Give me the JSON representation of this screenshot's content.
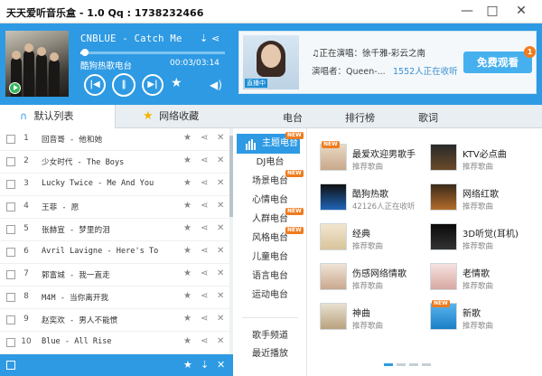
{
  "window": {
    "title": "天天爱听音乐盒 - 1.0      Qq : 1738232466",
    "min": "—",
    "max": "□",
    "close": "✕"
  },
  "player": {
    "song_title": "CNBLUE - Catch Me",
    "station": "酷狗热歌电台",
    "time": "00:03/03:14",
    "progress": 0.02,
    "icons": [
      "download-icon",
      "share-icon",
      "prev-icon",
      "pause-icon",
      "next-icon",
      "favorite-star-icon",
      "volume-icon",
      "play-icon"
    ]
  },
  "left_tabs": [
    "默认列表",
    "网络收藏"
  ],
  "playlist": [
    {
      "num": "1",
      "name": "回音哥 - 他和她"
    },
    {
      "num": "2",
      "name": "少女时代 - The Boys"
    },
    {
      "num": "3",
      "name": "Lucky Twice - Me And You"
    },
    {
      "num": "4",
      "name": "王菲 - 愿"
    },
    {
      "num": "5",
      "name": "张赫宣 - 梦里的泪"
    },
    {
      "num": "6",
      "name": "Avril Lavigne - Here's To"
    },
    {
      "num": "7",
      "name": "郭富城 - 我一直走"
    },
    {
      "num": "8",
      "name": "M4M - 当你离开我"
    },
    {
      "num": "9",
      "name": "赵奕欢 - 男人不能惯"
    },
    {
      "num": "10",
      "name": "Blue - All Rise"
    }
  ],
  "ad": {
    "live_badge": "直播中",
    "now_live": "♫正在演唱：徐千雅-彩云之南",
    "singer": "演唱者：Queen-...",
    "listeners": "1552人正在收听",
    "watch_button": "免费观看",
    "badge": "1"
  },
  "right_tabs": [
    "电台",
    "排行榜",
    "歌词"
  ],
  "categories": {
    "active": "主题电台",
    "items": [
      "DJ电台",
      "场景电台",
      "心情电台",
      "人群电台",
      "风格电台",
      "儿童电台",
      "语言电台",
      "运动电台"
    ],
    "extra": [
      "歌手频道",
      "最近播放"
    ],
    "new_tag": "NEW"
  },
  "cards": [
    {
      "title": "最爱欢迎男歌手",
      "sub": "推荐歌曲",
      "new": "NEW"
    },
    {
      "title": "KTV必点曲",
      "sub": "推荐歌曲"
    },
    {
      "title": "酷狗热歌",
      "sub": "42126人正在收听"
    },
    {
      "title": "网络红歌",
      "sub": "推荐歌曲"
    },
    {
      "title": "经典",
      "sub": "推荐歌曲"
    },
    {
      "title": "3D听觉(耳机)",
      "sub": "推荐歌曲"
    },
    {
      "title": "伤感网络情歌",
      "sub": "推荐歌曲"
    },
    {
      "title": "老情歌",
      "sub": "推荐歌曲"
    },
    {
      "title": "神曲",
      "sub": "推荐歌曲"
    },
    {
      "title": "新歌",
      "sub": "推荐歌曲",
      "new": "NEW"
    }
  ],
  "colors": {
    "accent": "#2e9ae3",
    "new_tag": "#f07b1d"
  }
}
